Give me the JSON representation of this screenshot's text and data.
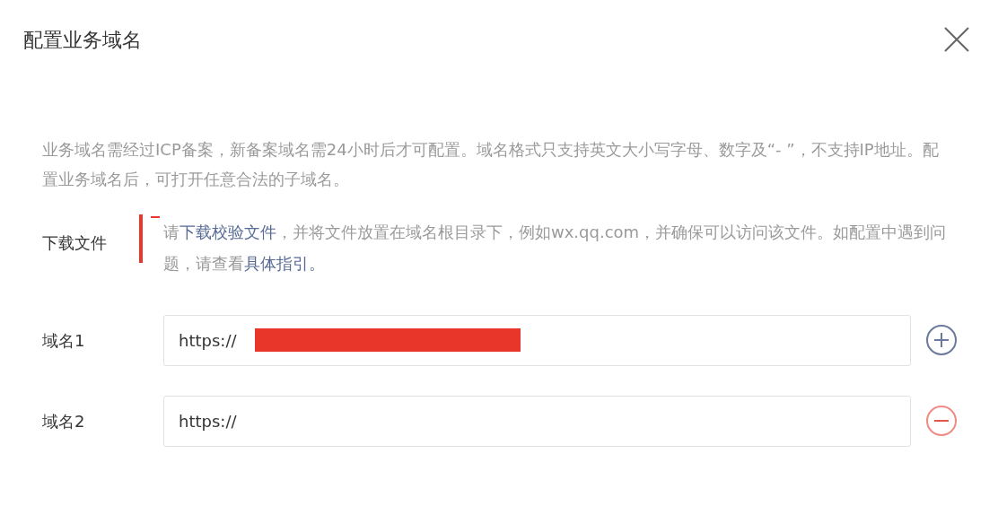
{
  "dialog": {
    "title": "配置业务域名"
  },
  "notice": "业务域名需经过ICP备案，新备案域名需24小时后才可配置。域名格式只支持英文大小写字母、数字及“- ”，不支持IP地址。配置业务域名后，可打开任意合法的子域名。",
  "download": {
    "label": "下载文件",
    "annotated": true,
    "parts": [
      {
        "kind": "text",
        "text": "请"
      },
      {
        "kind": "link",
        "text": "下载校验文件"
      },
      {
        "kind": "text",
        "text": "，并将文件放置在域名根目录下，例如wx.qq.com，并确保可以访问该文件。如配置中遇到问题，请查看"
      },
      {
        "kind": "link",
        "text": "具体指引。"
      }
    ]
  },
  "domains": [
    {
      "label": "域名1",
      "prefix": "https://",
      "redacted": true,
      "kind": "add"
    },
    {
      "label": "域名2",
      "prefix": "https://",
      "redacted": false,
      "kind": "remove"
    }
  ]
}
